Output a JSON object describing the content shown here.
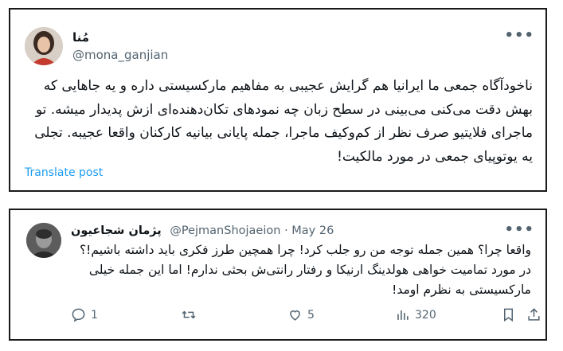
{
  "post": {
    "display_name": "مُنا",
    "handle": "@mona_ganjian",
    "text": "ناخودآگاه جمعی ما ایرانیا هم گرایش عجیبی به مفاهیم مارکسیستی داره و یه جاهایی که بهش دقت می‌کنی می‌بینی در سطح زبان چه نمودهای تکان‌دهنده‌ای ازش پدیدار میشه. تو ماجرای فلایتیو صرف نظر از کم‌وکیف ماجرا، جمله پایانی بیانیه کارکنان واقعا عجیبه. تجلی یه یوتوپیای جمعی در مورد مالکیت!",
    "translate_label": "Translate post",
    "more_icon": "more-icon"
  },
  "reply": {
    "display_name": "پژمان شجاعیون",
    "handle": "@PejmanShojaeion",
    "separator": "·",
    "date": "May 26",
    "text": "واقعا چرا؟ همین جمله توجه من رو جلب کرد! چرا همچین طرز فکری باید داشته باشیم!؟ در مورد تمامیت خواهی هولدینگ ارنیکا و رفتار رانتی‌ش بحثی ندارم! اما این جمله خیلی مارکسیستی به نظرم اومد!",
    "actions": {
      "reply_count": "1",
      "retweet_count": "",
      "like_count": "5",
      "views_count": "320"
    }
  }
}
